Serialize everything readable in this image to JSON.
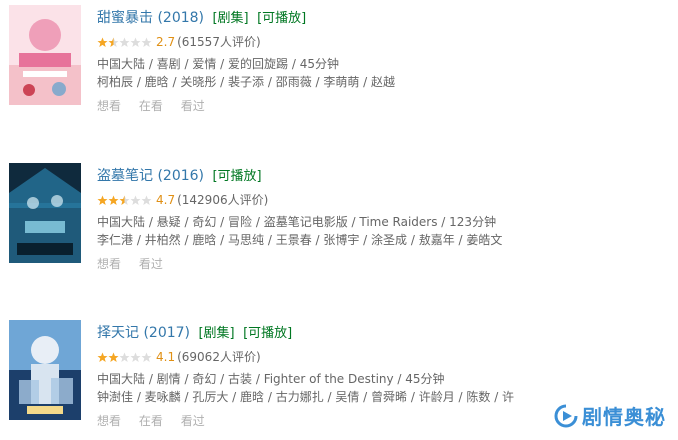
{
  "items": [
    {
      "title": "甜蜜暴击",
      "year": "(2018)",
      "tags": [
        "[剧集]",
        "[可播放]"
      ],
      "rating": 2.7,
      "score": "2.7",
      "votes": "(61557人评价)",
      "meta": "中国大陆 / 喜剧 / 爱情 / 爱的回旋踢 / 45分钟",
      "cast": "柯柏辰 / 鹿晗 / 关晓彤 / 裴子添 / 邵雨薇 / 李萌萌 / 赵越",
      "actions": [
        "想看",
        "在看",
        "看过"
      ],
      "poster_colors": [
        "#f4c1c9",
        "#e7739a",
        "#ffe3ec"
      ]
    },
    {
      "title": "盗墓笔记",
      "year": "(2016)",
      "tags": [
        "[可播放]"
      ],
      "rating": 4.7,
      "score": "4.7",
      "votes": "(142906人评价)",
      "meta": "中国大陆 / 悬疑 / 奇幻 / 冒险 / 盗墓笔记电影版 / Time Raiders / 123分钟",
      "cast": "李仁港 / 井柏然 / 鹿晗 / 马思纯 / 王景春 / 张博宇 / 涂圣成 / 敖嘉年 / 姜皓文",
      "actions": [
        "想看",
        "看过"
      ],
      "poster_colors": [
        "#0f2a3d",
        "#2a7fa8",
        "#8fd3e8"
      ]
    },
    {
      "title": "择天记",
      "year": "(2017)",
      "tags": [
        "[剧集]",
        "[可播放]"
      ],
      "rating": 4.1,
      "score": "4.1",
      "votes": "(69062人评价)",
      "meta": "中国大陆 / 剧情 / 奇幻 / 古装 / Fighter of the Destiny / 45分钟",
      "cast": "钟澍佳 / 麦咏麟 / 孔厉大 / 鹿晗 / 古力娜扎 / 吴倩 / 曾舜晞 / 许龄月 / 陈数 / 许",
      "actions": [
        "想看",
        "在看",
        "看过"
      ],
      "poster_colors": [
        "#1c3f6b",
        "#6fa6d6",
        "#e8eef6"
      ]
    }
  ],
  "watermark": "剧情奥秘",
  "colors": {
    "link": "#3377aa",
    "tag": "#007722",
    "star": "#f5a623",
    "star_empty": "#dddddd",
    "score": "#e09015"
  }
}
